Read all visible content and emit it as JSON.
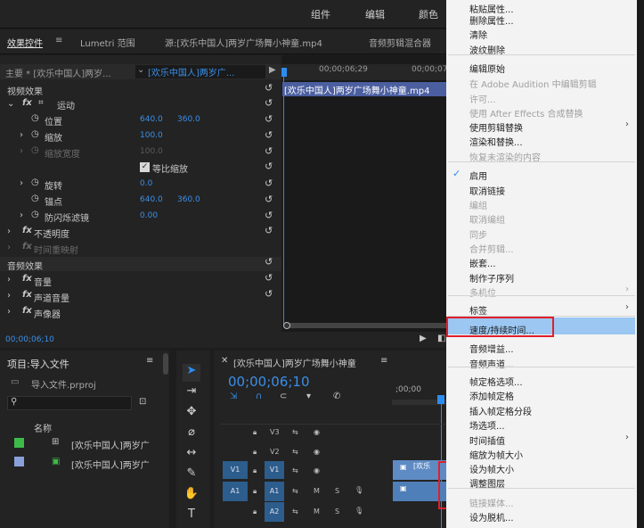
{
  "topbar": {
    "items": [
      "组件",
      "编辑",
      "颜色"
    ]
  },
  "tabs": {
    "effects": "效果控件",
    "menu_icon": "≡",
    "lumetri": "Lumetri 范围",
    "source": "源:[欢乐中国人]两岁广场舞小神童.mp4",
    "audio_mixer": "音频剪辑混合器"
  },
  "effects": {
    "master": "主要 * [欢乐中国人]两岁...",
    "clip_select": "[欢乐中国人]两岁广...",
    "time1": "00;00;06;29",
    "time2": "00;00;07",
    "video_effects": "视频效果",
    "fx": "fx",
    "motion": "运动",
    "position": "位置",
    "position_x": "640.0",
    "position_y": "360.0",
    "scale": "缩放",
    "scale_val": "100.0",
    "scale_width": "缩放宽度",
    "scale_width_val": "100.0",
    "uniform": "等比缩放",
    "rotation": "旋转",
    "rotation_val": "0.0",
    "anchor": "锚点",
    "anchor_x": "640.0",
    "anchor_y": "360.0",
    "flicker": "防闪烁滤镜",
    "flicker_val": "0.00",
    "opacity": "不透明度",
    "time_remap": "时间重映射",
    "audio_effects": "音频效果",
    "volume": "音量",
    "channel_volume": "声道音量",
    "panner": "声像器",
    "clip_name": "[欢乐中国人]两岁广场舞小神童.mp4",
    "current_time": "00;00;06;10"
  },
  "project": {
    "title": "项目:导入文件",
    "menu_icon": "≡",
    "file": "导入文件.prproj",
    "name_header": "名称",
    "items": [
      "[欢乐中国人]两岁广",
      "[欢乐中国人]两岁广"
    ],
    "item_colors": [
      "#3dbb4a",
      "#8aa0d8"
    ]
  },
  "timeline": {
    "title": "[欢乐中国人]两岁广场舞小神童",
    "menu_icon": "≡",
    "timecode": "00;00;06;10",
    "ruler": ";00;00",
    "tracks": [
      {
        "name": "V3",
        "src": ""
      },
      {
        "name": "V2",
        "src": ""
      },
      {
        "name": "V1",
        "src": "V1"
      },
      {
        "name": "A1",
        "src": "A1"
      },
      {
        "name": "A2",
        "src": ""
      }
    ],
    "m": "M",
    "s": "S",
    "clip_label": "[欢乐"
  },
  "context_menu": {
    "items": [
      {
        "label": "粘贴属性...",
        "disabled": false
      },
      {
        "label": "删除属性...",
        "disabled": false
      },
      {
        "label": "清除",
        "disabled": false
      },
      {
        "label": "波纹删除",
        "disabled": false
      },
      {
        "label": "编辑原始",
        "disabled": false
      },
      {
        "label": "在 Adobe Audition 中编辑剪辑",
        "disabled": true
      },
      {
        "label": "许可...",
        "disabled": true
      },
      {
        "label": "使用 After Effects 合成替换",
        "disabled": true
      },
      {
        "label": "使用剪辑替换",
        "disabled": false
      },
      {
        "label": "渲染和替换...",
        "disabled": false
      },
      {
        "label": "恢复未渲染的内容",
        "disabled": true
      },
      {
        "label": "启用",
        "disabled": false
      },
      {
        "label": "取消链接",
        "disabled": false
      },
      {
        "label": "编组",
        "disabled": true
      },
      {
        "label": "取消编组",
        "disabled": true
      },
      {
        "label": "同步",
        "disabled": true
      },
      {
        "label": "合并剪辑...",
        "disabled": true
      },
      {
        "label": "嵌套...",
        "disabled": false
      },
      {
        "label": "制作子序列",
        "disabled": false
      },
      {
        "label": "多机位",
        "disabled": true
      },
      {
        "label": "标签",
        "disabled": false
      },
      {
        "label": "速度/持续时间...",
        "disabled": false
      },
      {
        "label": "音频增益...",
        "disabled": false
      },
      {
        "label": "音频声道...",
        "disabled": false
      },
      {
        "label": "帧定格选项...",
        "disabled": false
      },
      {
        "label": "添加帧定格",
        "disabled": false
      },
      {
        "label": "插入帧定格分段",
        "disabled": false
      },
      {
        "label": "场选项...",
        "disabled": false
      },
      {
        "label": "时间插值",
        "disabled": false
      },
      {
        "label": "缩放为帧大小",
        "disabled": false
      },
      {
        "label": "设为帧大小",
        "disabled": false
      },
      {
        "label": "调整图层",
        "disabled": false
      },
      {
        "label": "链接媒体...",
        "disabled": true
      },
      {
        "label": "设为脱机...",
        "disabled": false
      }
    ],
    "checkmark": "✓",
    "submenu_arrow": "›"
  }
}
